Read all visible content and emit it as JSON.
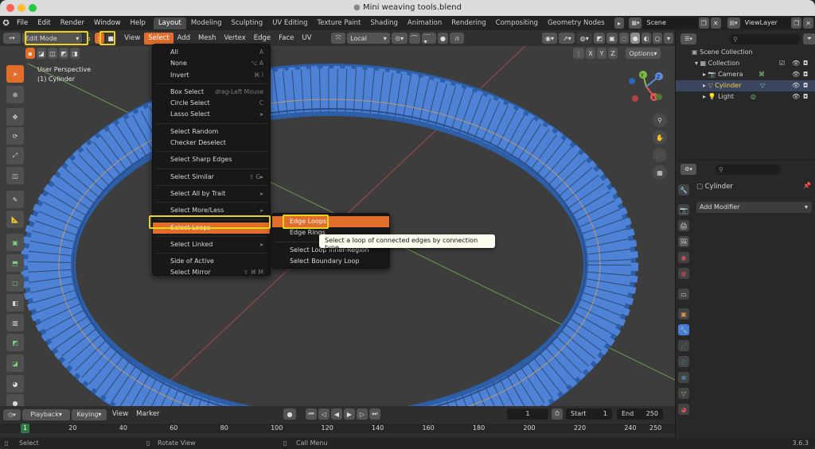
{
  "window": {
    "title": "Mini weaving tools.blend",
    "version": "3.6.3"
  },
  "app_menu": [
    "File",
    "Edit",
    "Render",
    "Window",
    "Help"
  ],
  "workspaces": [
    "Layout",
    "Modeling",
    "Sculpting",
    "UV Editing",
    "Texture Paint",
    "Shading",
    "Animation",
    "Rendering",
    "Compositing",
    "Geometry Nodes"
  ],
  "scene": "Scene",
  "view_layer": "ViewLayer",
  "header": {
    "mode": "Edit Mode",
    "menus": [
      "View",
      "Select",
      "Add",
      "Mesh",
      "Vertex",
      "Edge",
      "Face",
      "UV"
    ],
    "pivot": "Local",
    "options": "Options",
    "axes": [
      "X",
      "Y",
      "Z"
    ]
  },
  "viewport": {
    "perspective": "User Perspective",
    "object": "(1) Cylinder"
  },
  "select_menu": [
    {
      "label": "All",
      "shortcut": "A"
    },
    {
      "label": "None",
      "shortcut": "⌥ A"
    },
    {
      "label": "Invert",
      "shortcut": "⌘ I"
    },
    {
      "sep": true
    },
    {
      "label": "Box Select",
      "shortcut": "drag-Left Mouse"
    },
    {
      "label": "Circle Select",
      "shortcut": "C"
    },
    {
      "label": "Lasso Select",
      "shortcut": "▸"
    },
    {
      "sep": true
    },
    {
      "label": "Select Random",
      "shortcut": ""
    },
    {
      "label": "Checker Deselect",
      "shortcut": ""
    },
    {
      "sep": true
    },
    {
      "label": "Select Sharp Edges",
      "shortcut": ""
    },
    {
      "sep": true
    },
    {
      "label": "Select Similar",
      "shortcut": "⇧ G▸"
    },
    {
      "sep": true
    },
    {
      "label": "Select All by Trait",
      "shortcut": "▸"
    },
    {
      "sep": true
    },
    {
      "label": "Select More/Less",
      "shortcut": "▸"
    },
    {
      "sep": true
    },
    {
      "label": "Select Loops",
      "shortcut": "▸",
      "highlight": true
    },
    {
      "sep": true
    },
    {
      "label": "Select Linked",
      "shortcut": "▸"
    },
    {
      "sep": true
    },
    {
      "label": "Side of Active",
      "shortcut": ""
    },
    {
      "label": "Select Mirror",
      "shortcut": "⇧ ⌘ M"
    }
  ],
  "loops_menu": [
    {
      "label": "Edge Loops",
      "highlight": true
    },
    {
      "label": "Edge Rings"
    },
    {
      "sep": true
    },
    {
      "label": "Select Loop Inner-Region"
    },
    {
      "label": "Select Boundary Loop"
    }
  ],
  "tooltip": "Select a loop of connected edges by connection type.",
  "outliner": {
    "root": "Scene Collection",
    "collection": "Collection",
    "items": [
      "Camera",
      "Cylinder",
      "Light"
    ]
  },
  "properties": {
    "object": "Cylinder",
    "add_modifier": "Add Modifier"
  },
  "timeline": {
    "playback": "Playback",
    "keying": "Keying",
    "view": "View",
    "marker": "Marker",
    "frame": "1",
    "start_label": "Start",
    "start": "1",
    "end_label": "End",
    "end": "250",
    "ticks": [
      "1",
      "20",
      "40",
      "60",
      "80",
      "100",
      "120",
      "140",
      "160",
      "180",
      "200",
      "220",
      "240",
      "250"
    ]
  },
  "statusbar": {
    "left": "Select",
    "mid": "Rotate View",
    "right": "Call Menu"
  },
  "colors": {
    "accent": "#e06d2a",
    "mesh": "#4d82d6",
    "highlight": "#e9d41a"
  }
}
